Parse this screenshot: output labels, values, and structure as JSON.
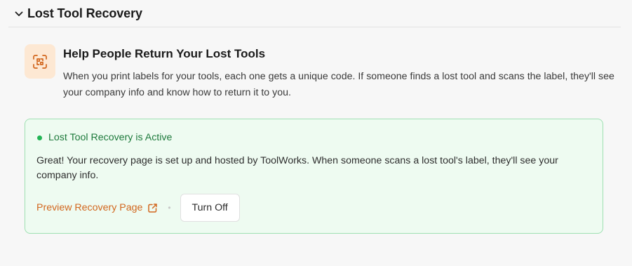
{
  "section": {
    "title": "Lost Tool Recovery",
    "toggle_icon": "chevron-down-icon"
  },
  "intro": {
    "icon": "scan-qr-icon",
    "title": "Help People Return Your Lost Tools",
    "description": "When you print labels for your tools, each one gets a unique code. If someone finds a lost tool and scans the label, they'll see your company info and know how to return it to you."
  },
  "status": {
    "label": "Lost Tool Recovery is Active",
    "message": "Great! Your recovery page is set up and hosted by ToolWorks. When someone scans a lost tool's label, they'll see your company info.",
    "preview_link": "Preview Recovery Page",
    "preview_icon": "external-link-icon",
    "separator": "•",
    "turn_off_label": "Turn Off"
  },
  "colors": {
    "accent": "#d2661d",
    "icon_bg": "#fde8d3",
    "success": "#22b455",
    "success_text": "#1e7a3c",
    "card_bg": "#eefbf1",
    "card_border": "#9fe0b2"
  }
}
